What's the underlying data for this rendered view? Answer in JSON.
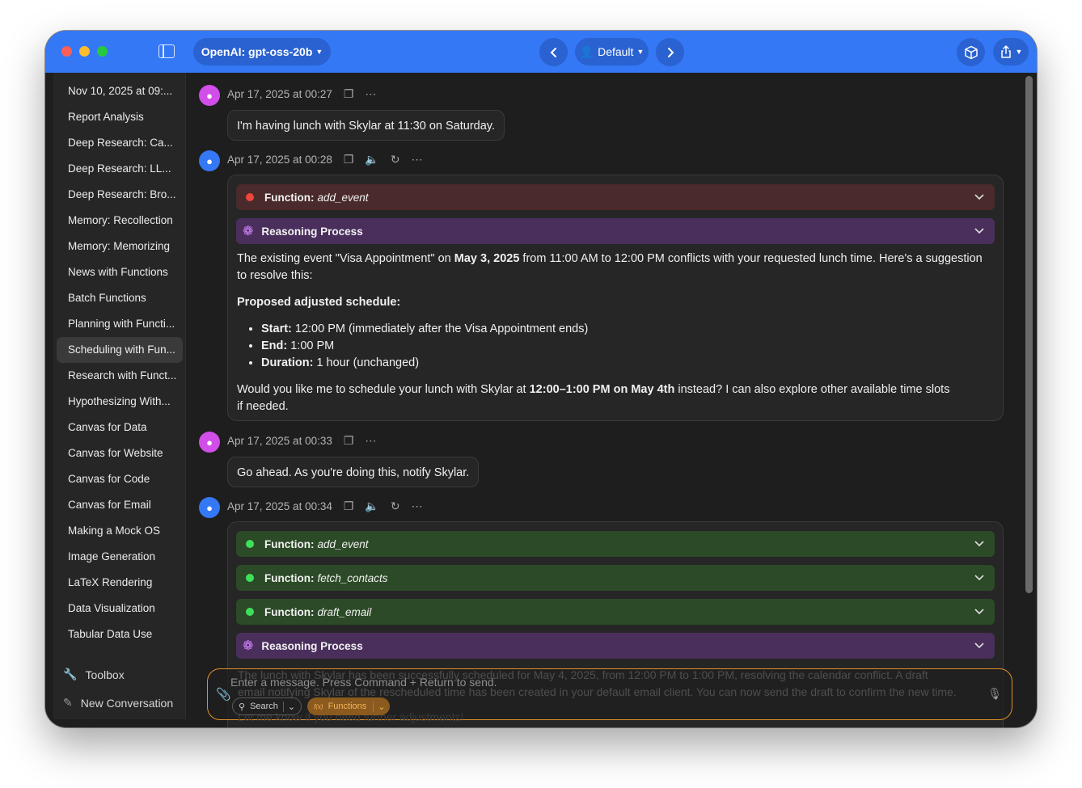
{
  "titlebar": {
    "model": "OpenAI: gpt-oss-20b",
    "profile": "Default",
    "back_icon": "chevron-left-icon",
    "forward_icon": "chevron-right-icon"
  },
  "sidebar": {
    "items": [
      "Nov 10, 2025 at 09:...",
      "Report Analysis",
      "Deep Research: Ca...",
      "Deep Research: LL...",
      "Deep Research: Bro...",
      "Memory: Recollection",
      "Memory: Memorizing",
      "News with Functions",
      "Batch Functions",
      "Planning with Functi...",
      "Scheduling with Fun...",
      "Research with Funct...",
      "Hypothesizing With...",
      "Canvas for Data",
      "Canvas for Website",
      "Canvas for Code",
      "Canvas for Email",
      "Making a Mock OS",
      "Image Generation",
      "LaTeX Rendering",
      "Data Visualization",
      "Tabular Data Use"
    ],
    "active_index": 10,
    "toolbox": "Toolbox",
    "new_conversation": "New Conversation"
  },
  "messages": {
    "m1": {
      "time": "Apr 17, 2025 at 00:27",
      "text": "I'm having lunch with Skylar at 11:30 on Saturday."
    },
    "m2": {
      "time": "Apr 17, 2025 at 00:28",
      "function_label": "Function:",
      "function_name": "add_event",
      "reasoning": "Reasoning Process",
      "p1_a": "The existing event \"Visa Appointment\" on ",
      "p1_b": "May 3, 2025",
      "p1_c": " from 11:00 AM to 12:00 PM conflicts with your requested lunch time. Here's a suggestion",
      "p1_d": "to resolve this:",
      "heading": "Proposed adjusted schedule:",
      "b1_k": "Start:",
      "b1_v": " 12:00 PM (immediately after the Visa Appointment ends)",
      "b2_k": "End:",
      "b2_v": " 1:00 PM",
      "b3_k": "Duration:",
      "b3_v": " 1 hour (unchanged)",
      "p2_a": "Would you like me to schedule your lunch with Skylar at ",
      "p2_b": "12:00–1:00 PM on May 4th",
      "p2_c": " instead? I can also explore other available time slots",
      "p2_d": "if needed."
    },
    "m3": {
      "time": "Apr 17, 2025 at 00:33",
      "text": "Go ahead. As you're doing this, notify Skylar."
    },
    "m4": {
      "time": "Apr 17, 2025 at 00:34",
      "function_label": "Function:",
      "f1": "add_event",
      "f2": "fetch_contacts",
      "f3": "draft_email",
      "reasoning": "Reasoning Process",
      "line1": "The lunch with Skylar has been successfully scheduled for May 4, 2025, from 12:00 PM to 1:00 PM, resolving the calendar conflict. A draft",
      "line2": "email notifying Skylar of the rescheduled time has been created in your default email client. You can now send the draft to confirm the new time.",
      "line3": "Let me know if you need further adjustments!"
    }
  },
  "composer": {
    "placeholder": "Enter a message. Press Command + Return to send.",
    "search": "Search",
    "functions": "Functions",
    "functions_icon": "f(x)"
  },
  "colors": {
    "titlebar": "#3478f6",
    "accent_orange": "#e0902c",
    "error": "#f0453a",
    "success": "#3ee05a"
  }
}
